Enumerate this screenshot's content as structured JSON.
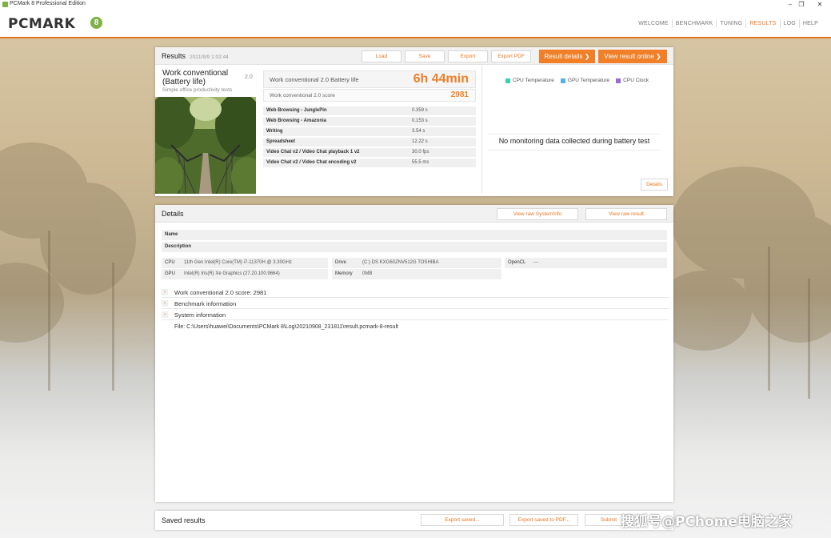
{
  "window": {
    "title": "PCMark 8 Professional Edition",
    "minimize": "–",
    "maximize": "❐",
    "close": "✕"
  },
  "header": {
    "logo": "PCMARK",
    "logo_badge": "8",
    "nav": [
      {
        "label": "WELCOME",
        "active": false
      },
      {
        "label": "BENCHMARK",
        "active": false
      },
      {
        "label": "TUNING",
        "active": false
      },
      {
        "label": "RESULTS",
        "active": true
      },
      {
        "label": "LOG",
        "active": false
      },
      {
        "label": "HELP",
        "active": false
      }
    ]
  },
  "results": {
    "title": "Results",
    "timestamp": "2021/9/9 1:02:44",
    "buttons": {
      "load": "Load",
      "save": "Save",
      "export": "Export",
      "export_pdf": "Export PDF",
      "result_details": "Result details",
      "view_online": "View result online"
    },
    "test": {
      "name": "Work conventional (Battery life)",
      "version": "2.0",
      "description": "Simple office productivity tests"
    },
    "battery_label": "Work conventional 2.0 Battery life",
    "battery_value": "6h 44min",
    "score_label": "Work conventional 2.0 score",
    "score_value": "2981",
    "subtests": [
      {
        "name": "Web Browsing - JunglePin",
        "value": "0.359 s"
      },
      {
        "name": "Web Browsing - Amazonia",
        "value": "0.153 s"
      },
      {
        "name": "Writing",
        "value": "3.54 s"
      },
      {
        "name": "Spreadsheet",
        "value": "12.22 s"
      },
      {
        "name": "Video Chat v2 / Video Chat playback 1 v2",
        "value": "30.0 fps"
      },
      {
        "name": "Video Chat v2 / Video Chat encoding v2",
        "value": "55.5 ms"
      }
    ],
    "monitoring": {
      "legend": [
        {
          "label": "CPU Temperature",
          "color": "#3ccfb0"
        },
        {
          "label": "GPU Temperature",
          "color": "#4fb3e8"
        },
        {
          "label": "CPU Clock",
          "color": "#9b6bd4"
        }
      ],
      "message": "No monitoring data collected during battery test",
      "details_button": "Details"
    }
  },
  "details": {
    "title": "Details",
    "view_raw_sysinfo": "View raw SystemInfo",
    "view_raw_result": "View raw result",
    "name_label": "Name",
    "name_value": "",
    "description_label": "Description",
    "description_value": "",
    "cpu_label": "CPU",
    "cpu_value": "11th Gen Intel(R) Core(TM) i7-11370H @ 3.30GHz",
    "gpu_label": "GPU",
    "gpu_value": "Intel(R) Iris(R) Xe Graphics (27.20.100.9664)",
    "drive_label": "Drive",
    "drive_value": "(C:) DS KXG60ZNV512G TOSHIBA",
    "memory_label": "Memory",
    "memory_value": "0MB",
    "opencl_label": "OpenCL",
    "opencl_value": "---",
    "expanders": [
      "Work conventional 2.0 score: 2981",
      "Benchmark information",
      "System information"
    ],
    "file_path": "File: C:\\Users\\huawei\\Documents\\PCMark 8\\Log\\20210908_231811\\result.pcmark-8-result"
  },
  "saved": {
    "title": "Saved results",
    "export_saved": "Export saved...",
    "export_saved_pdf": "Export saved to PDF...",
    "submit": "Submit"
  },
  "watermark": "搜狐号@PChome电脑之家"
}
